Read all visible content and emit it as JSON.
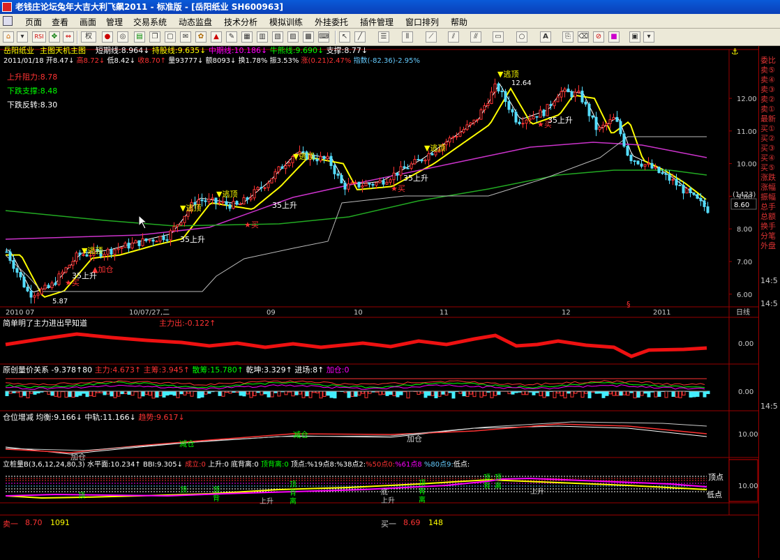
{
  "window": {
    "title": "老钱庄论坛兔年大吉大利飞飙2011 - 标准版 - [岳阳纸业 SH600963]"
  },
  "menu": [
    "页面",
    "查看",
    "画面",
    "管理",
    "交易系统",
    "动态监盘",
    "技术分析",
    "模拟训练",
    "外挂委托",
    "插件管理",
    "窗口排列",
    "帮助"
  ],
  "toolbar": {
    "rsi": "RSI",
    "quan": "权"
  },
  "main": {
    "name": "岳阳纸业",
    "subtitle": "主图天机主图",
    "ind": [
      {
        "t": "短期线:8.964↓",
        "c": "#ffffff"
      },
      {
        "t": "持股线:9.635↓",
        "c": "#ffff00"
      },
      {
        "t": "中期线:10.186↓",
        "c": "#ff00ff"
      },
      {
        "t": "牛熊线:9.690↓",
        "c": "#00ff00"
      },
      {
        "t": "支撑:8.77↓",
        "c": "#ffffff"
      }
    ],
    "line2": [
      {
        "t": "2011/01/18",
        "c": "#ffffff"
      },
      {
        "t": "开8.47↓",
        "c": "#ffffff"
      },
      {
        "t": "高8.72↓",
        "c": "#ff3333"
      },
      {
        "t": "低8.42↓",
        "c": "#ffffff"
      },
      {
        "t": "收8.70↑",
        "c": "#ff3333"
      },
      {
        "t": "量93777↓",
        "c": "#ffffff"
      },
      {
        "t": "额8093↓",
        "c": "#ffffff"
      },
      {
        "t": "换1.78%",
        "c": "#ffffff"
      },
      {
        "t": "振3.53%",
        "c": "#ffffff"
      },
      {
        "t": "涨(0.21)2.47%",
        "c": "#ff3333"
      },
      {
        "t": "指数(-82.36)-2.95%",
        "c": "#66ccff"
      }
    ],
    "info1": "上升阻力:8.78",
    "info2": "下跌支撑:8.48",
    "info3": "下跌反转:8.30",
    "hi_label": "12.64",
    "lo_label": "5.87",
    "price_axis": [
      "12.00",
      "11.00",
      "10.00",
      "9.00",
      "8.00",
      "7.00",
      "6.00"
    ],
    "price_box": "8.60",
    "vol_box": "(1423)",
    "dates": [
      "2010 07",
      "10/07/27,二",
      "09",
      "10",
      "11",
      "12",
      "2011"
    ],
    "rixian": "日线",
    "annot": [
      {
        "t": "▼逃顶",
        "c": "#ffff00"
      },
      {
        "t": "▼逃顶",
        "c": "#ffff00"
      },
      {
        "t": "▼逃顶",
        "c": "#ffff00"
      },
      {
        "t": "▼逃顶",
        "c": "#ffff00"
      },
      {
        "t": "▼逃顶",
        "c": "#ffff00"
      },
      {
        "t": "▼逃顶",
        "c": "#ffff00"
      },
      {
        "t": "▲加仓",
        "c": "#ff3333"
      },
      {
        "t": "★买",
        "c": "#ff3333"
      },
      {
        "t": "★买",
        "c": "#ff3333"
      },
      {
        "t": "★买",
        "c": "#ff3333"
      },
      {
        "t": "★买",
        "c": "#ff3333"
      },
      {
        "t": "35上升",
        "c": "#ffffff"
      },
      {
        "t": "35上升",
        "c": "#ffffff"
      },
      {
        "t": "35上升",
        "c": "#ffffff"
      },
      {
        "t": "35上升",
        "c": "#ffffff"
      },
      {
        "t": "35上升",
        "c": "#ffffff"
      }
    ]
  },
  "p1": {
    "title": "简单明了主力进出早知道",
    "label": "主力出:-0.122↑",
    "axis": "0.00"
  },
  "p2": {
    "title": "原创量价关系",
    "items": [
      {
        "t": "-9.378↑80",
        "c": "#ffffff"
      },
      {
        "t": "主力:4.673↑",
        "c": "#ff3333"
      },
      {
        "t": "主筹:3.945↑",
        "c": "#ff3333"
      },
      {
        "t": "散筹:15.780↑",
        "c": "#00ff00"
      },
      {
        "t": "乾坤:3.329↑",
        "c": "#ffffff"
      },
      {
        "t": "进场:8↑",
        "c": "#ffffff"
      },
      {
        "t": "加仓:0",
        "c": "#ff00ff"
      }
    ],
    "axis": "0.00"
  },
  "p3": {
    "title": "仓位增减",
    "items": [
      {
        "t": "均衡:9.166↓",
        "c": "#ffffff"
      },
      {
        "t": "中轨:11.166↓",
        "c": "#ffffff"
      },
      {
        "t": "趋势:9.617↓",
        "c": "#ff3333"
      }
    ],
    "labels": [
      "加仓",
      "减仓",
      "减仓",
      "加仓"
    ],
    "axis": "10.00"
  },
  "p4": {
    "title": "立桩量B(3,6,12,24,80,3)",
    "items": [
      {
        "t": "水平面:10.234↑",
        "c": "#ffffff"
      },
      {
        "t": "BBI:9.305↓",
        "c": "#ffffff"
      },
      {
        "t": "成立:0",
        "c": "#ff3333"
      },
      {
        "t": "上升:0",
        "c": "#ffffff"
      },
      {
        "t": "底背离:0",
        "c": "#ffffff"
      },
      {
        "t": "顶背离:0",
        "c": "#00ff00"
      },
      {
        "t": "顶点:%19点8:%38点2:",
        "c": "#ffffff"
      },
      {
        "t": "%50点0:",
        "c": "#ff3333"
      },
      {
        "t": "%61点8",
        "c": "#ff00ff"
      },
      {
        "t": "%80点9:",
        "c": "#66ccff"
      },
      {
        "t": "低点:",
        "c": "#ffffff"
      }
    ],
    "top_label": "顶点",
    "bottom_label": "低点",
    "axis": "10.00",
    "marks": [
      "顶",
      "背",
      "离",
      "上升",
      "底",
      "背",
      "离"
    ]
  },
  "status": {
    "sell_label": "卖一",
    "sell_price": "8.70",
    "sell_vol": "1091",
    "buy_label": "买一",
    "buy_price": "8.69",
    "buy_vol": "148"
  },
  "right_panel": {
    "items": [
      "委比",
      "卖⑤",
      "卖④",
      "卖③",
      "卖②",
      "卖①",
      "最新",
      "买①",
      "买②",
      "买③",
      "买④",
      "买⑤",
      "涨跌",
      "涨幅",
      "振幅",
      "总手",
      "总额",
      "换手",
      "分笔",
      "外盘"
    ],
    "scale": [
      "14:5",
      "14:5",
      "14:5"
    ]
  },
  "colors": {
    "up": "#ff3333",
    "down": "#55ddff",
    "frame": "#990000",
    "bg": "#000000"
  }
}
